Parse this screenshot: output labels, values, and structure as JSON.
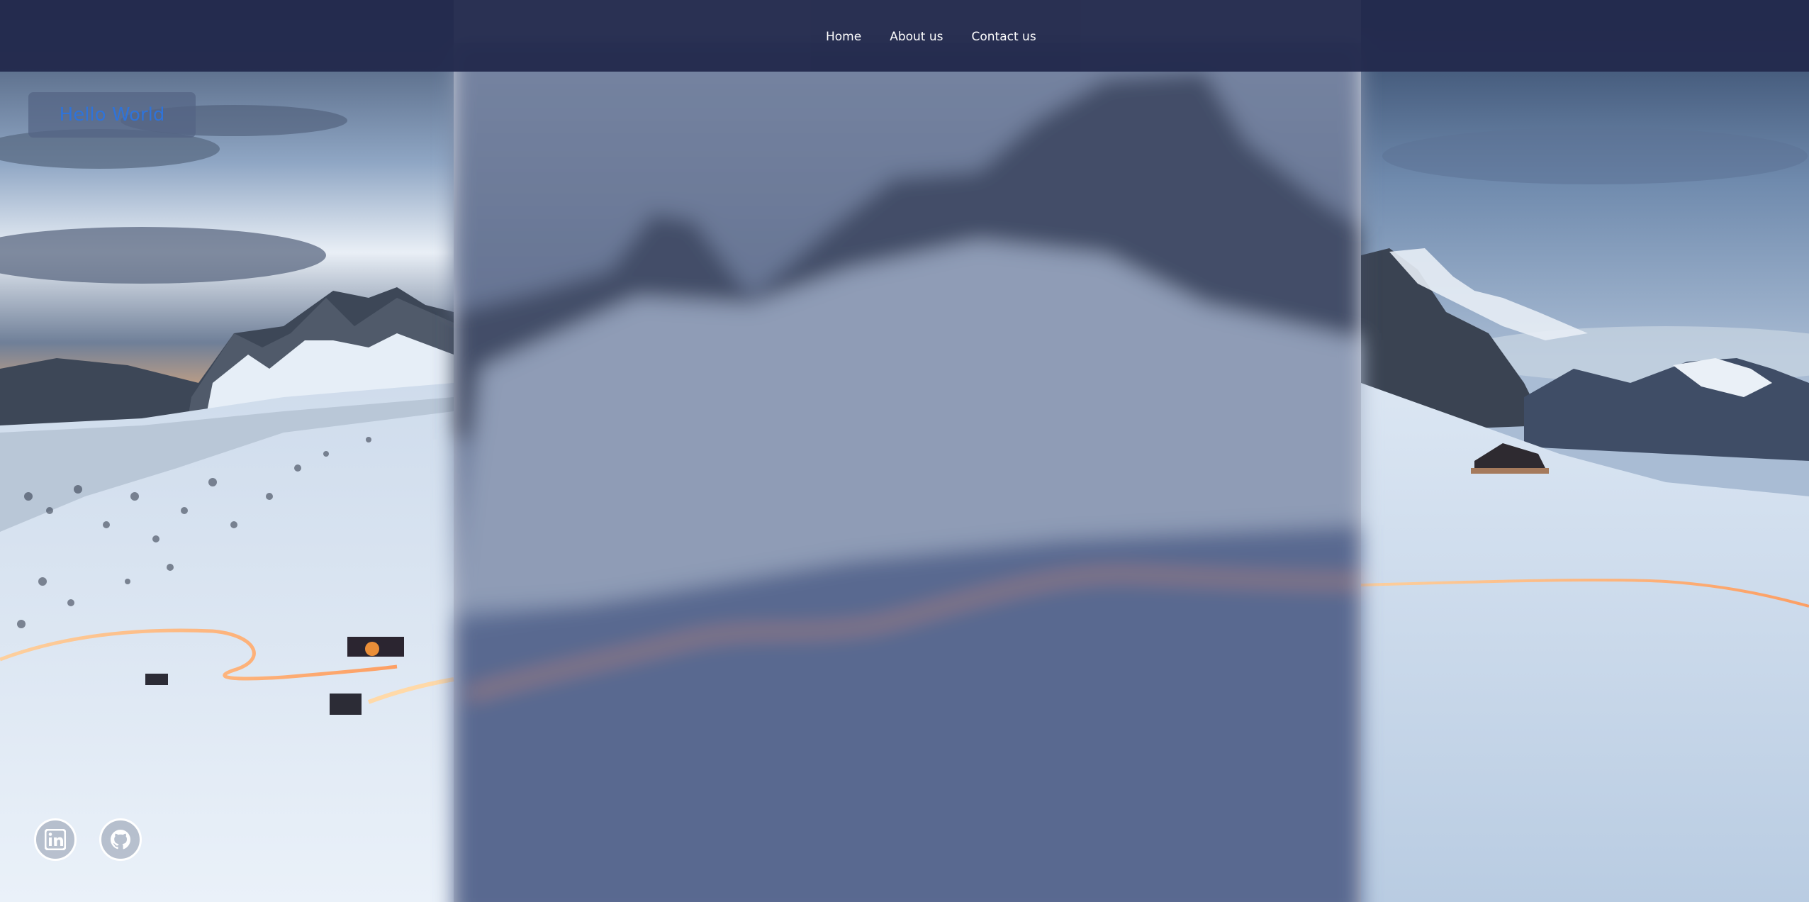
{
  "nav": {
    "items": [
      {
        "label": "Home"
      },
      {
        "label": "About us"
      },
      {
        "label": "Contact us"
      }
    ]
  },
  "hero": {
    "heading": "Hello World"
  },
  "social": {
    "items": [
      {
        "icon": "linkedin-icon"
      },
      {
        "icon": "github-icon"
      }
    ]
  },
  "colors": {
    "navbar": "#232a4d",
    "heading_text": "#2f73d9",
    "overlay_panel": "#4a5a82"
  }
}
